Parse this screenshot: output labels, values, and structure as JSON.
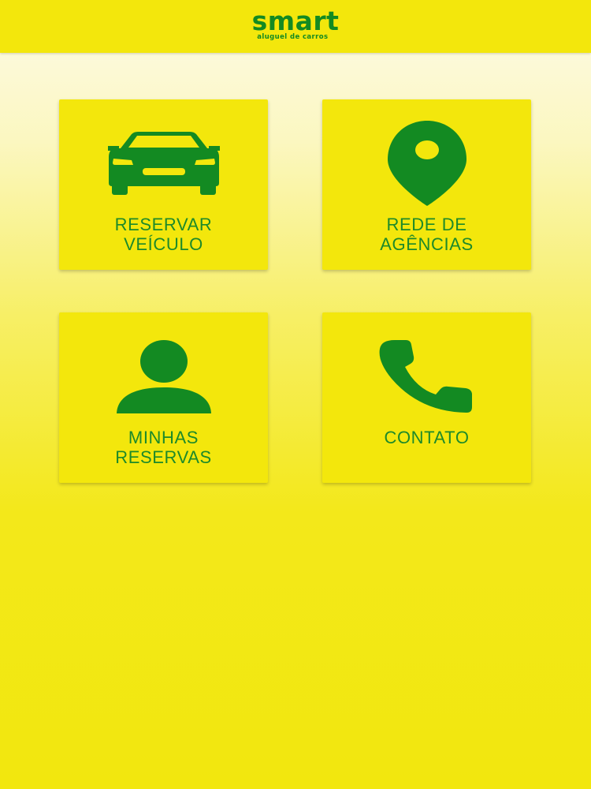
{
  "header": {
    "logo_word": "smart",
    "logo_tagline": "aluguel de carros"
  },
  "menu": {
    "reserve": {
      "line1": "RESERVAR",
      "line2": "VEÍCULO",
      "icon": "car-icon"
    },
    "agencies": {
      "line1": "REDE DE",
      "line2": "AGÊNCIAS",
      "icon": "map-pin-icon"
    },
    "reservations": {
      "line1": "MINHAS",
      "line2": "RESERVAS",
      "icon": "person-icon"
    },
    "contact": {
      "line1": "CONTATO",
      "icon": "phone-icon"
    }
  },
  "colors": {
    "brand_green": "#138a22",
    "brand_yellow": "#f3e70c"
  }
}
